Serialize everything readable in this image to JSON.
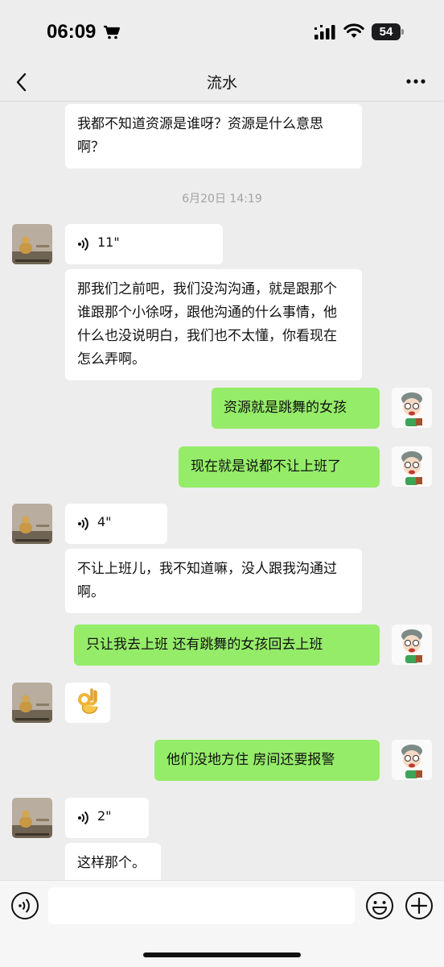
{
  "status_bar": {
    "time": "06:09",
    "battery": "54"
  },
  "nav": {
    "title": "流水"
  },
  "messages": {
    "m1_text": "我都不知道资源是谁呀？资源是什么意思啊？",
    "timestamp": "6月20日 14:19",
    "voice1_duration": "11\"",
    "m2_text": "那我们之前吧，我们没沟沟通，就是跟那个谁跟那个小徐呀，跟他沟通的什么事情，他什么也没说明白，我们也不太懂，你看现在怎么弄啊。",
    "m3_text": "资源就是跳舞的女孩",
    "m4_text": "现在就是说都不让上班了",
    "voice2_duration": "4\"",
    "m5_text": "不让上班儿，我不知道嘛，没人跟我沟通过啊。",
    "m6_text": "只让我去上班  还有跳舞的女孩回去上班",
    "m7_emoji": "ok-hand-emoji",
    "m8_text": "他们没地方住  房间还要报警",
    "voice3_duration": "2\"",
    "m9_text": "这样那个。"
  },
  "icons": {
    "back": "chevron-left-icon",
    "more": "more-icon",
    "voice_toggle": "voice-input-icon",
    "emoji": "emoji-icon",
    "plus": "plus-icon"
  },
  "colors": {
    "background": "#ededed",
    "outgoing_bubble": "#95ec69",
    "incoming_bubble": "#ffffff"
  }
}
